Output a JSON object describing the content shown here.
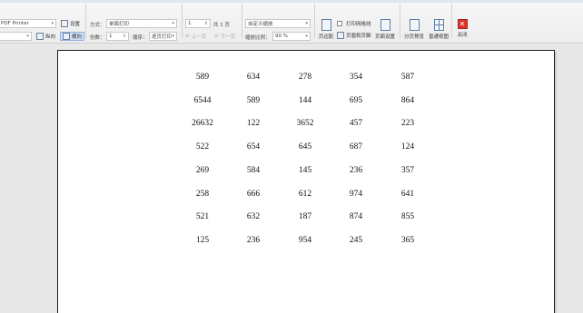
{
  "toolbar": {
    "printer": "PDF Printer",
    "settings_label": "设置",
    "preview_label": "纵向",
    "landscape_label": "横向",
    "mode_label": "方式：",
    "mode_value": "单面打印",
    "copies_label": "份数：",
    "copies_value": "1",
    "order_label": "顺序：",
    "order_value": "逐页打印",
    "page_value": "1",
    "page_total": "共 1 页",
    "prev_label": "上一页",
    "next_label": "下一页",
    "scale_mode": "自定义缩放",
    "scale_label": "缩放比例：",
    "scale_value": "90 %",
    "margins_label": "页边距",
    "gridlines_label": "打印网格线",
    "header_footer_label": "页眉和页脚",
    "page_setup_label": "页面设置",
    "page_break_label": "分页预览",
    "normal_view_label": "普通视图",
    "close_label": "关闭"
  },
  "sheet": {
    "rows": [
      [
        "589",
        "634",
        "278",
        "354",
        "587"
      ],
      [
        "6544",
        "589",
        "144",
        "695",
        "864"
      ],
      [
        "26632",
        "122",
        "3652",
        "457",
        "223"
      ],
      [
        "522",
        "654",
        "645",
        "687",
        "124"
      ],
      [
        "269",
        "584",
        "145",
        "236",
        "357"
      ],
      [
        "258",
        "666",
        "612",
        "974",
        "641"
      ],
      [
        "521",
        "632",
        "187",
        "874",
        "855"
      ],
      [
        "125",
        "236",
        "954",
        "245",
        "365"
      ]
    ]
  }
}
